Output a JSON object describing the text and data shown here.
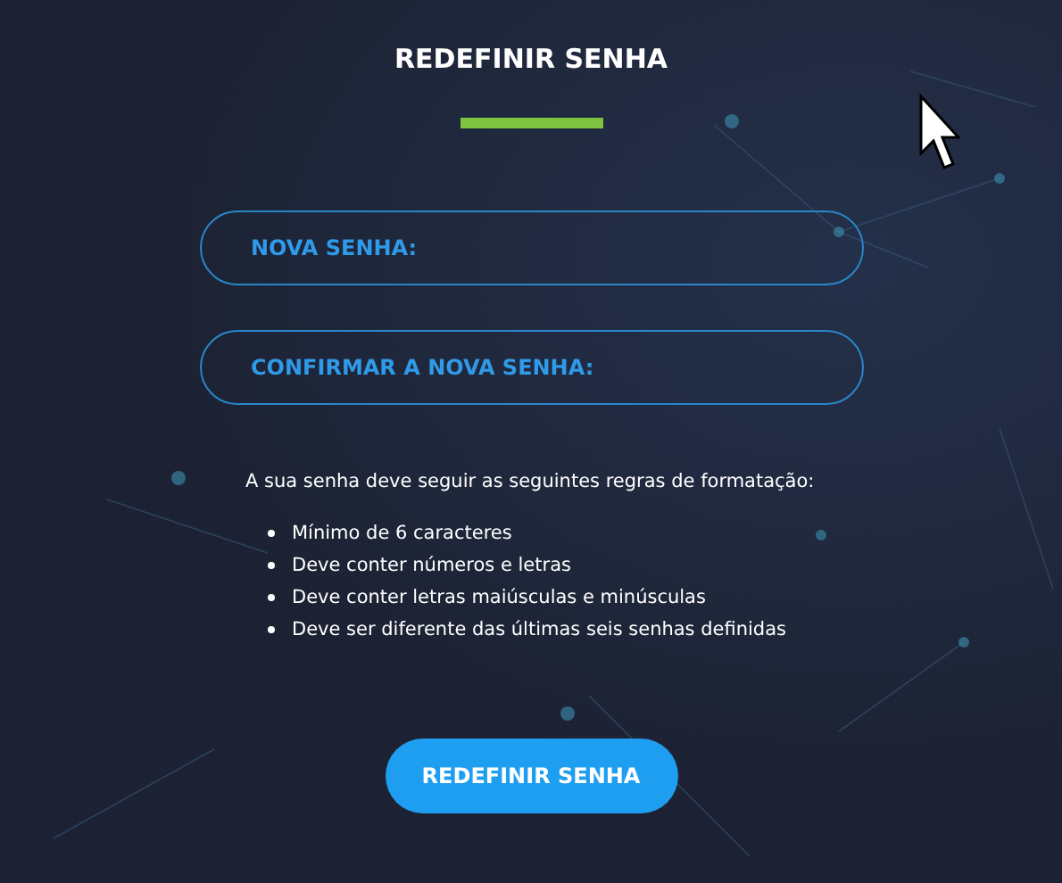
{
  "title": "REDEFINIR SENHA",
  "fields": [
    {
      "placeholder": "NOVA SENHA:"
    },
    {
      "placeholder": "CONFIRMAR A NOVA SENHA:"
    }
  ],
  "rules": {
    "intro": "A sua senha deve seguir as seguintes regras de formatação:",
    "items": [
      "Mínimo de 6 caracteres",
      "Deve conter números e letras",
      "Deve conter letras maiúsculas e minúsculas",
      "Deve ser diferente das últimas seis senhas definidas"
    ]
  },
  "submit": "REDEFINIR SENHA"
}
